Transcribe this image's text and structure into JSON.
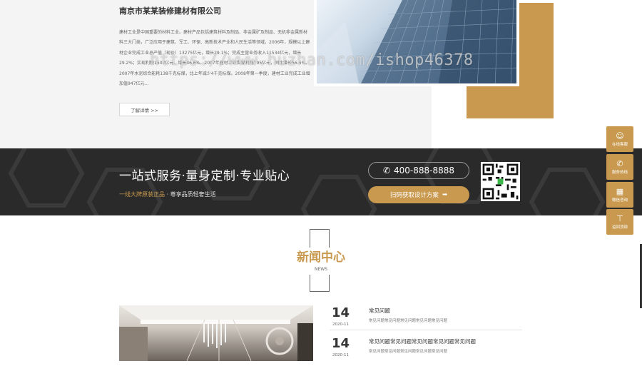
{
  "about": {
    "company": "南京市某某装修建材有限公司",
    "intro": "建材工业是中国重要的材料工业。建材产品包括建筑材料及制品、非金属矿及制品、无机非金属新材料三大门类，广泛应用于建筑、军工、环保、高新技术产业和人民生活等领域。2006年，规模以上建材企业完成工业总产值（现价）13275亿元，增长29.1%；完成主营业务收入11534亿元，增长29.2%；实现利税1503亿元，增长46.6%。2007年建材工业实现利润795亿元，同比增长56.6%。2007年水泥综合能耗138千克标煤，比上年减少4千克标煤。2008年第一季度，建材工业完成工业增加值947亿元...",
    "more_label": "了解详情 >>",
    "watermark": "https://www.huzhan.com/ishop46378"
  },
  "banner": {
    "title": "一站式服务·量身定制·专业贴心",
    "sub_gold": "一线大牌原装正品",
    "sub_rest": " · 尊享品质轻奢生活",
    "phone": "400-888-8888",
    "scan_label": "扫码获取设计方案"
  },
  "float": [
    {
      "label": "在线客服",
      "icon": "chat-icon"
    },
    {
      "label": "服务热线",
      "icon": "phone-icon"
    },
    {
      "label": "微信咨询",
      "icon": "qr-icon"
    },
    {
      "label": "返回顶部",
      "icon": "top-icon"
    }
  ],
  "news": {
    "title": "新闻中心",
    "en": "NEWS",
    "items": [
      {
        "day": "14",
        "ym": "2020-11",
        "title": "常见问题",
        "desc": "常见问题常见问题常见问题常见问题常见问题"
      },
      {
        "day": "14",
        "ym": "2020-11",
        "title": "常见问题常见问题常见问题常见问题常见问题",
        "desc": "常见问题常见问题常见问题常见问题常见问题"
      }
    ]
  },
  "colors": {
    "accent": "#c8994e",
    "dark": "#2a2a2a"
  }
}
